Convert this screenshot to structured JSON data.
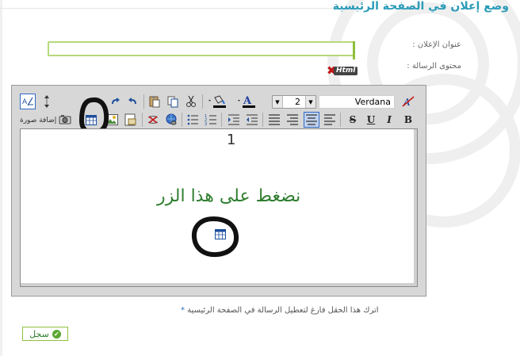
{
  "page": {
    "title": "وضع إعلان في الصفحة الرئيسية"
  },
  "form": {
    "ad_title_label": "عنوان الإعلان :",
    "message_label": "محتوى الرسالة :",
    "ad_title_value": "",
    "html_badge": "Html"
  },
  "toolbar": {
    "font_name": "Verdana",
    "font_size": "2",
    "insert_picture_label": "إضافة صورة",
    "bold": "B",
    "italic": "I",
    "underline": "U",
    "strike": "S",
    "font_color": "A"
  },
  "editor": {
    "content_number": "1",
    "content_hint": "نضغط على هذا الزر"
  },
  "footer": {
    "note": "اترك هذا الحقل فارغ لتعطيل الرسالة في الصفحة الرئيسية",
    "note_star": "*",
    "save_label": "سجل"
  },
  "colors": {
    "title": "#2a9bb8",
    "accent_green": "#8fbf3c",
    "hint_green": "#2f7d2f"
  },
  "icons": {
    "html": "html-icon",
    "table": "table-icon",
    "camera": "camera-icon",
    "image": "image-icon",
    "save_ok": "check-circle-icon"
  }
}
